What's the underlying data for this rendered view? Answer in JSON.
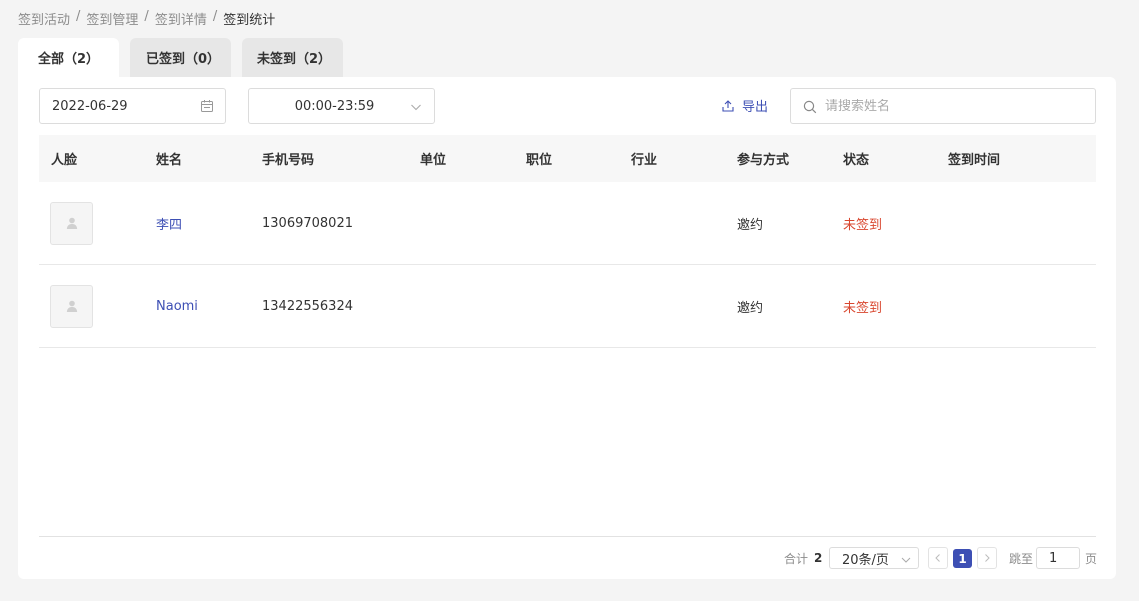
{
  "breadcrumb": {
    "items": [
      "签到活动",
      "签到管理",
      "签到详情"
    ],
    "current": "签到统计",
    "separator": "/"
  },
  "tabs": [
    {
      "label": "全部（2）",
      "active": true
    },
    {
      "label": "已签到（0）",
      "active": false
    },
    {
      "label": "未签到（2）",
      "active": false
    }
  ],
  "filters": {
    "date_value": "2022-06-29",
    "time_range_value": "00:00-23:59",
    "export_label": "导出",
    "search_placeholder": "请搜索姓名"
  },
  "table": {
    "columns": [
      "人脸",
      "姓名",
      "手机号码",
      "单位",
      "职位",
      "行业",
      "参与方式",
      "状态",
      "签到时间"
    ],
    "rows": [
      {
        "name": "李四",
        "phone": "13069708021",
        "unit": "",
        "position": "",
        "industry": "",
        "method": "邀约",
        "status": "未签到",
        "signin_time": ""
      },
      {
        "name": "Naomi",
        "phone": "13422556324",
        "unit": "",
        "position": "",
        "industry": "",
        "method": "邀约",
        "status": "未签到",
        "signin_time": ""
      }
    ]
  },
  "pagination": {
    "total_label": "合计",
    "total_count": "2",
    "page_size": "20条/页",
    "current_page": "1",
    "jump_label": "跳至",
    "jump_value": "1",
    "page_suffix": "页"
  },
  "colors": {
    "accent": "#3d4fb4",
    "status_unsigned": "#d9472f"
  }
}
